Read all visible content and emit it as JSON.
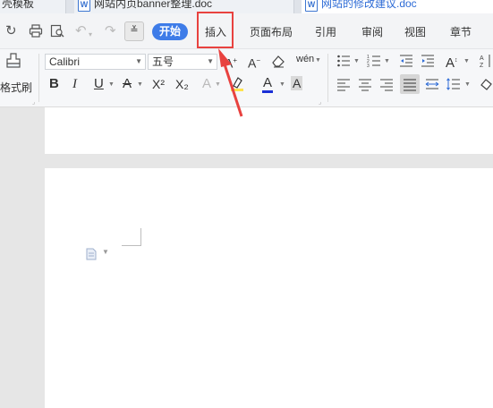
{
  "tabs": [
    {
      "label": "壳模板"
    },
    {
      "label": "网站内页banner整理.doc"
    },
    {
      "label": "网站的修改建议.doc"
    }
  ],
  "tab_icon_letter": "W",
  "tab_close_dot": "●",
  "quick_access": {
    "redo_icon": "↻",
    "undo_icon": "↶",
    "redo2_icon": "↷",
    "more_icon": "≚"
  },
  "menu": {
    "start": "开始",
    "insert": "插入",
    "page_layout": "页面布局",
    "references": "引用",
    "review": "审阅",
    "view": "视图",
    "sections": "章节"
  },
  "format_painter_label": "格式刷",
  "font": {
    "family": "Calibri",
    "size": "五号"
  },
  "font_buttons": {
    "bold": "B",
    "italic": "I",
    "underline": "U",
    "strike": "A",
    "superscript": "X²",
    "subscript": "X₂",
    "text_effect": "A",
    "font_color": "A",
    "char_shading": "A",
    "grow": "A",
    "shrink": "A",
    "pinyin": "wén"
  },
  "colors": {
    "accent": "#3e7ce8",
    "highlight": "#e8423f",
    "font_color_bar": "#1a2fd6",
    "highlight_bar": "#ffe34d"
  }
}
